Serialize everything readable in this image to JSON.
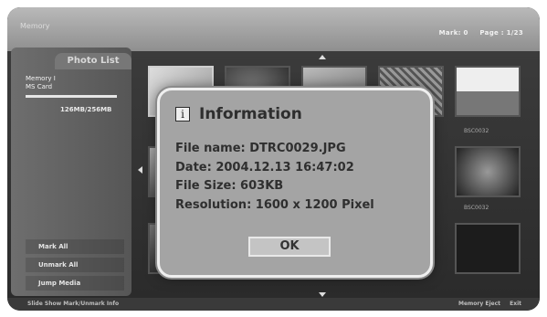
{
  "header": {
    "title": "Memory",
    "marks": "Mark: 0",
    "page": "Page : 1/23"
  },
  "sidebar": {
    "tab_label": "Photo List",
    "device_line1": "Memory I",
    "device_line2": "MS Card",
    "capacity": "126MB/256MB",
    "buttons": [
      "Mark All",
      "Unmark All",
      "Jump Media"
    ]
  },
  "thumbnails": {
    "labels": [
      "BSC0032",
      "BSC0032"
    ]
  },
  "footer": {
    "left": "Slide Show  Mark/Unmark  Info",
    "right_items": [
      "Memory Eject",
      "Exit"
    ]
  },
  "dialog": {
    "icon": "i",
    "title": "Information",
    "file_name": "File name: DTRC0029.JPG",
    "date": "Date: 2004.12.13    16:47:02",
    "file_size": "File Size: 603KB",
    "resolution": "Resolution: 1600 x 1200 Pixel",
    "ok_label": "OK"
  },
  "colors": {
    "dialog_bg": "#a4a4a4",
    "dialog_border": "#efefef",
    "text": "#2f2f2f"
  }
}
